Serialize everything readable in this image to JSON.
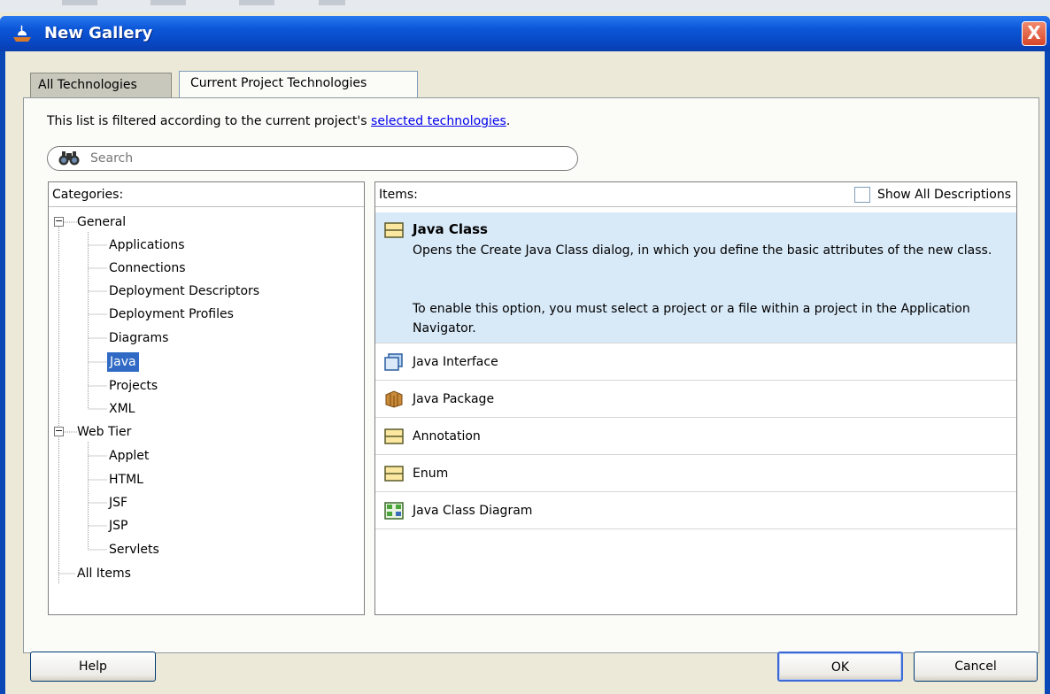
{
  "window": {
    "title": "New Gallery",
    "close_label": "X"
  },
  "tabs": [
    {
      "label": "All Technologies",
      "active": false
    },
    {
      "label": "Current Project Technologies",
      "active": true
    }
  ],
  "filter": {
    "text": "This list is filtered according to the current project's ",
    "link": "selected technologies",
    "suffix": "."
  },
  "search": {
    "placeholder": "Search",
    "value": ""
  },
  "categories": {
    "header": "Categories:",
    "groups": [
      {
        "label": "General",
        "children": [
          "Applications",
          "Connections",
          "Deployment Descriptors",
          "Deployment Profiles",
          "Diagrams",
          "Java",
          "Projects",
          "XML"
        ]
      },
      {
        "label": "Web Tier",
        "children": [
          "Applet",
          "HTML",
          "JSF",
          "JSP",
          "Servlets"
        ]
      }
    ],
    "all_items": "All Items",
    "selected": "Java"
  },
  "items": {
    "header": "Items:",
    "show_all_label": "Show All Descriptions",
    "show_all_checked": false,
    "selected": {
      "title": "Java Class",
      "desc1": "Opens the Create Java Class dialog, in which you define the basic attributes of the new class.",
      "desc2": "To enable this option, you must select a project or a file within a project in the Application Navigator.",
      "icon": "java-class-icon"
    },
    "list": [
      {
        "label": "Java Interface",
        "icon": "java-interface-icon"
      },
      {
        "label": "Java Package",
        "icon": "java-package-icon"
      },
      {
        "label": "Annotation",
        "icon": "annotation-icon"
      },
      {
        "label": "Enum",
        "icon": "enum-icon"
      },
      {
        "label": "Java Class Diagram",
        "icon": "class-diagram-icon"
      }
    ]
  },
  "buttons": {
    "help": "Help",
    "ok": "OK",
    "cancel": "Cancel"
  },
  "colors": {
    "titlebar": "#0847c4",
    "selection": "#316ac5",
    "selected_item_bg": "#d8e9f7",
    "link": "#0000ee"
  }
}
